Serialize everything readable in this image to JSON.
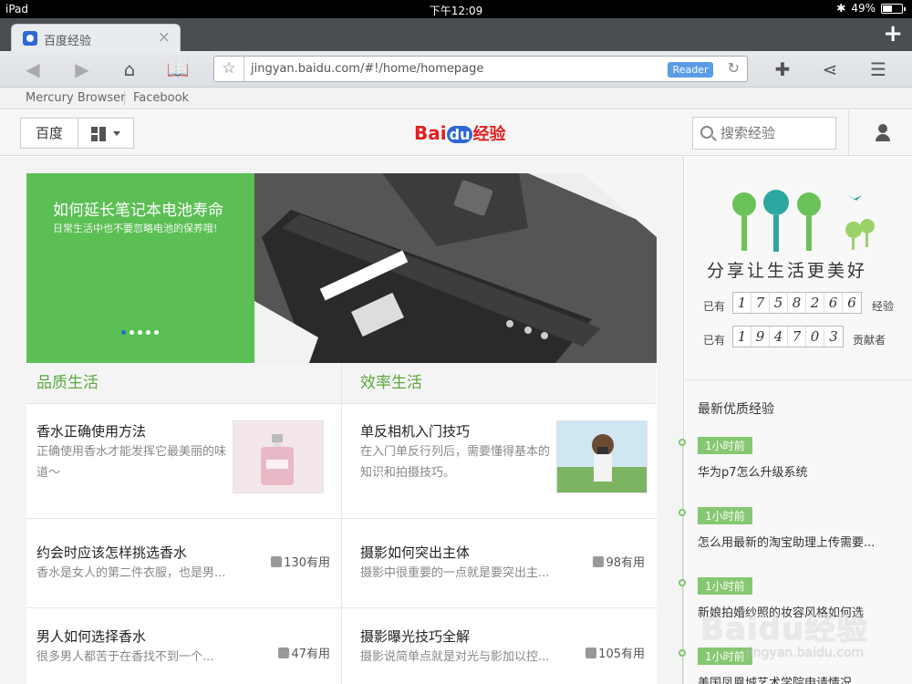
{
  "status": {
    "device": "iPad",
    "time": "下午12:09",
    "battery": "49%",
    "battery_fraction": 0.49
  },
  "tab": {
    "title": "百度经验"
  },
  "toolbar": {
    "url": "jingyan.baidu.com/#!/home/homepage",
    "reader_label": "Reader"
  },
  "bookmarks": [
    "Mercury Browser",
    "Facebook"
  ],
  "header": {
    "home_label": "百度",
    "logo_text_a": "Bai",
    "logo_text_b": "du",
    "logo_text_c": "经验",
    "search_placeholder": "搜索经验"
  },
  "banner": {
    "title": "如何延长笔记本电池寿命",
    "subtitle": "日常生活中也不要忽略电池的保养哦!",
    "slides": 5,
    "active_slide": 1
  },
  "sections": [
    {
      "title": "品质生活",
      "featured": {
        "title": "香水正确使用方法",
        "desc": "正确使用香水才能发挥它最美丽的味道～"
      },
      "items": [
        {
          "title": "约会时应该怎样挑选香水",
          "desc": "香水是女人的第二件衣服，也是男...",
          "likes": "130有用"
        },
        {
          "title": "男人如何选择香水",
          "desc": "很多男人都苦于在香找不到一个...",
          "likes": "47有用"
        }
      ]
    },
    {
      "title": "效率生活",
      "featured": {
        "title": "单反相机入门技巧",
        "desc": "在入门单反行列后，需要懂得基本的知识和拍摄技巧。"
      },
      "items": [
        {
          "title": "摄影如何突出主体",
          "desc": "摄影中很重要的一点就是要突出主...",
          "likes": "98有用"
        },
        {
          "title": "摄影曝光技巧全解",
          "desc": "摄影说简单点就是对光与影加以控...",
          "likes": "105有用"
        }
      ]
    }
  ],
  "sidebar": {
    "slogan": "分享让生活更美好",
    "stat1": {
      "prefix": "已有",
      "digits": [
        "1",
        "7",
        "5",
        "8",
        "2",
        "6",
        "6"
      ],
      "suffix": "经验"
    },
    "stat2": {
      "prefix": "已有",
      "digits": [
        "1",
        "9",
        "4",
        "7",
        "0",
        "3"
      ],
      "suffix": "贡献者"
    },
    "latest_title": "最新优质经验",
    "latest": [
      {
        "time": "1小时前",
        "text": "华为p7怎么升级系统"
      },
      {
        "time": "1小时前",
        "text": "怎么用最新的淘宝助理上传需要..."
      },
      {
        "time": "1小时前",
        "text": "新娘拍婚纱照的妆容风格如何选"
      },
      {
        "time": "1小时前",
        "text": "美国凤凰城艺术学院申请情况"
      }
    ]
  },
  "watermark": {
    "line1": "Baidu经验",
    "line2": "jingyan.baidu.com"
  }
}
